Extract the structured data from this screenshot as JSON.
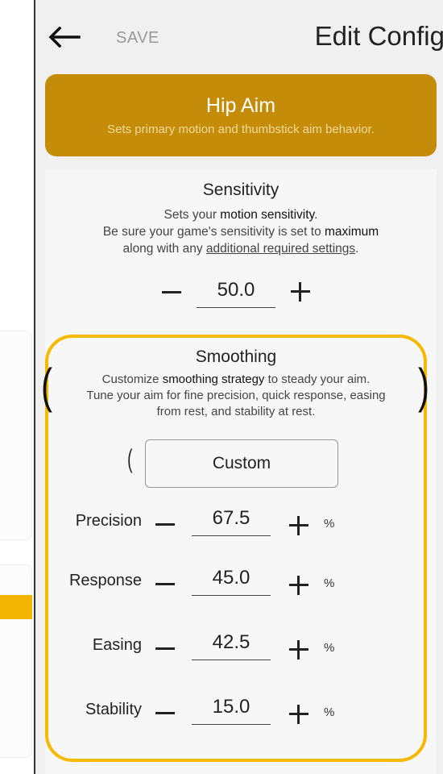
{
  "header": {
    "save_label": "SAVE",
    "title": "Edit Config"
  },
  "hero": {
    "title": "Hip Aim",
    "subtitle": "Sets primary motion and thumbstick aim behavior."
  },
  "sensitivity": {
    "title": "Sensitivity",
    "desc_1a": "Sets your ",
    "desc_1b": "motion sensitivity",
    "desc_1c": ".",
    "desc_2a": "Be sure your game's sensitivity is set to ",
    "desc_2b": "maximum",
    "desc_3a": "along with any ",
    "desc_3b": "additional required settings",
    "desc_3c": ".",
    "value": "50.0"
  },
  "smoothing": {
    "title": "Smoothing",
    "desc_1a": "Customize ",
    "desc_1b": "smoothing strategy",
    "desc_1c": " to steady your aim.",
    "desc_2": "Tune your aim for fine precision, quick response, easing",
    "desc_3": "from rest, and stability at rest.",
    "preset": "Custom",
    "unit": "%",
    "params": [
      {
        "label": "Precision",
        "value": "67.5"
      },
      {
        "label": "Response",
        "value": "45.0"
      },
      {
        "label": "Easing",
        "value": "42.5"
      },
      {
        "label": "Stability",
        "value": "15.0"
      }
    ]
  },
  "colors": {
    "accent": "#c58c09",
    "highlight": "#f7b800",
    "panel": "#f0f0f0"
  },
  "icons": [
    "back-arrow-icon",
    "minus-icon",
    "plus-icon",
    "chevron-left-icon",
    "chevron-right-icon"
  ]
}
